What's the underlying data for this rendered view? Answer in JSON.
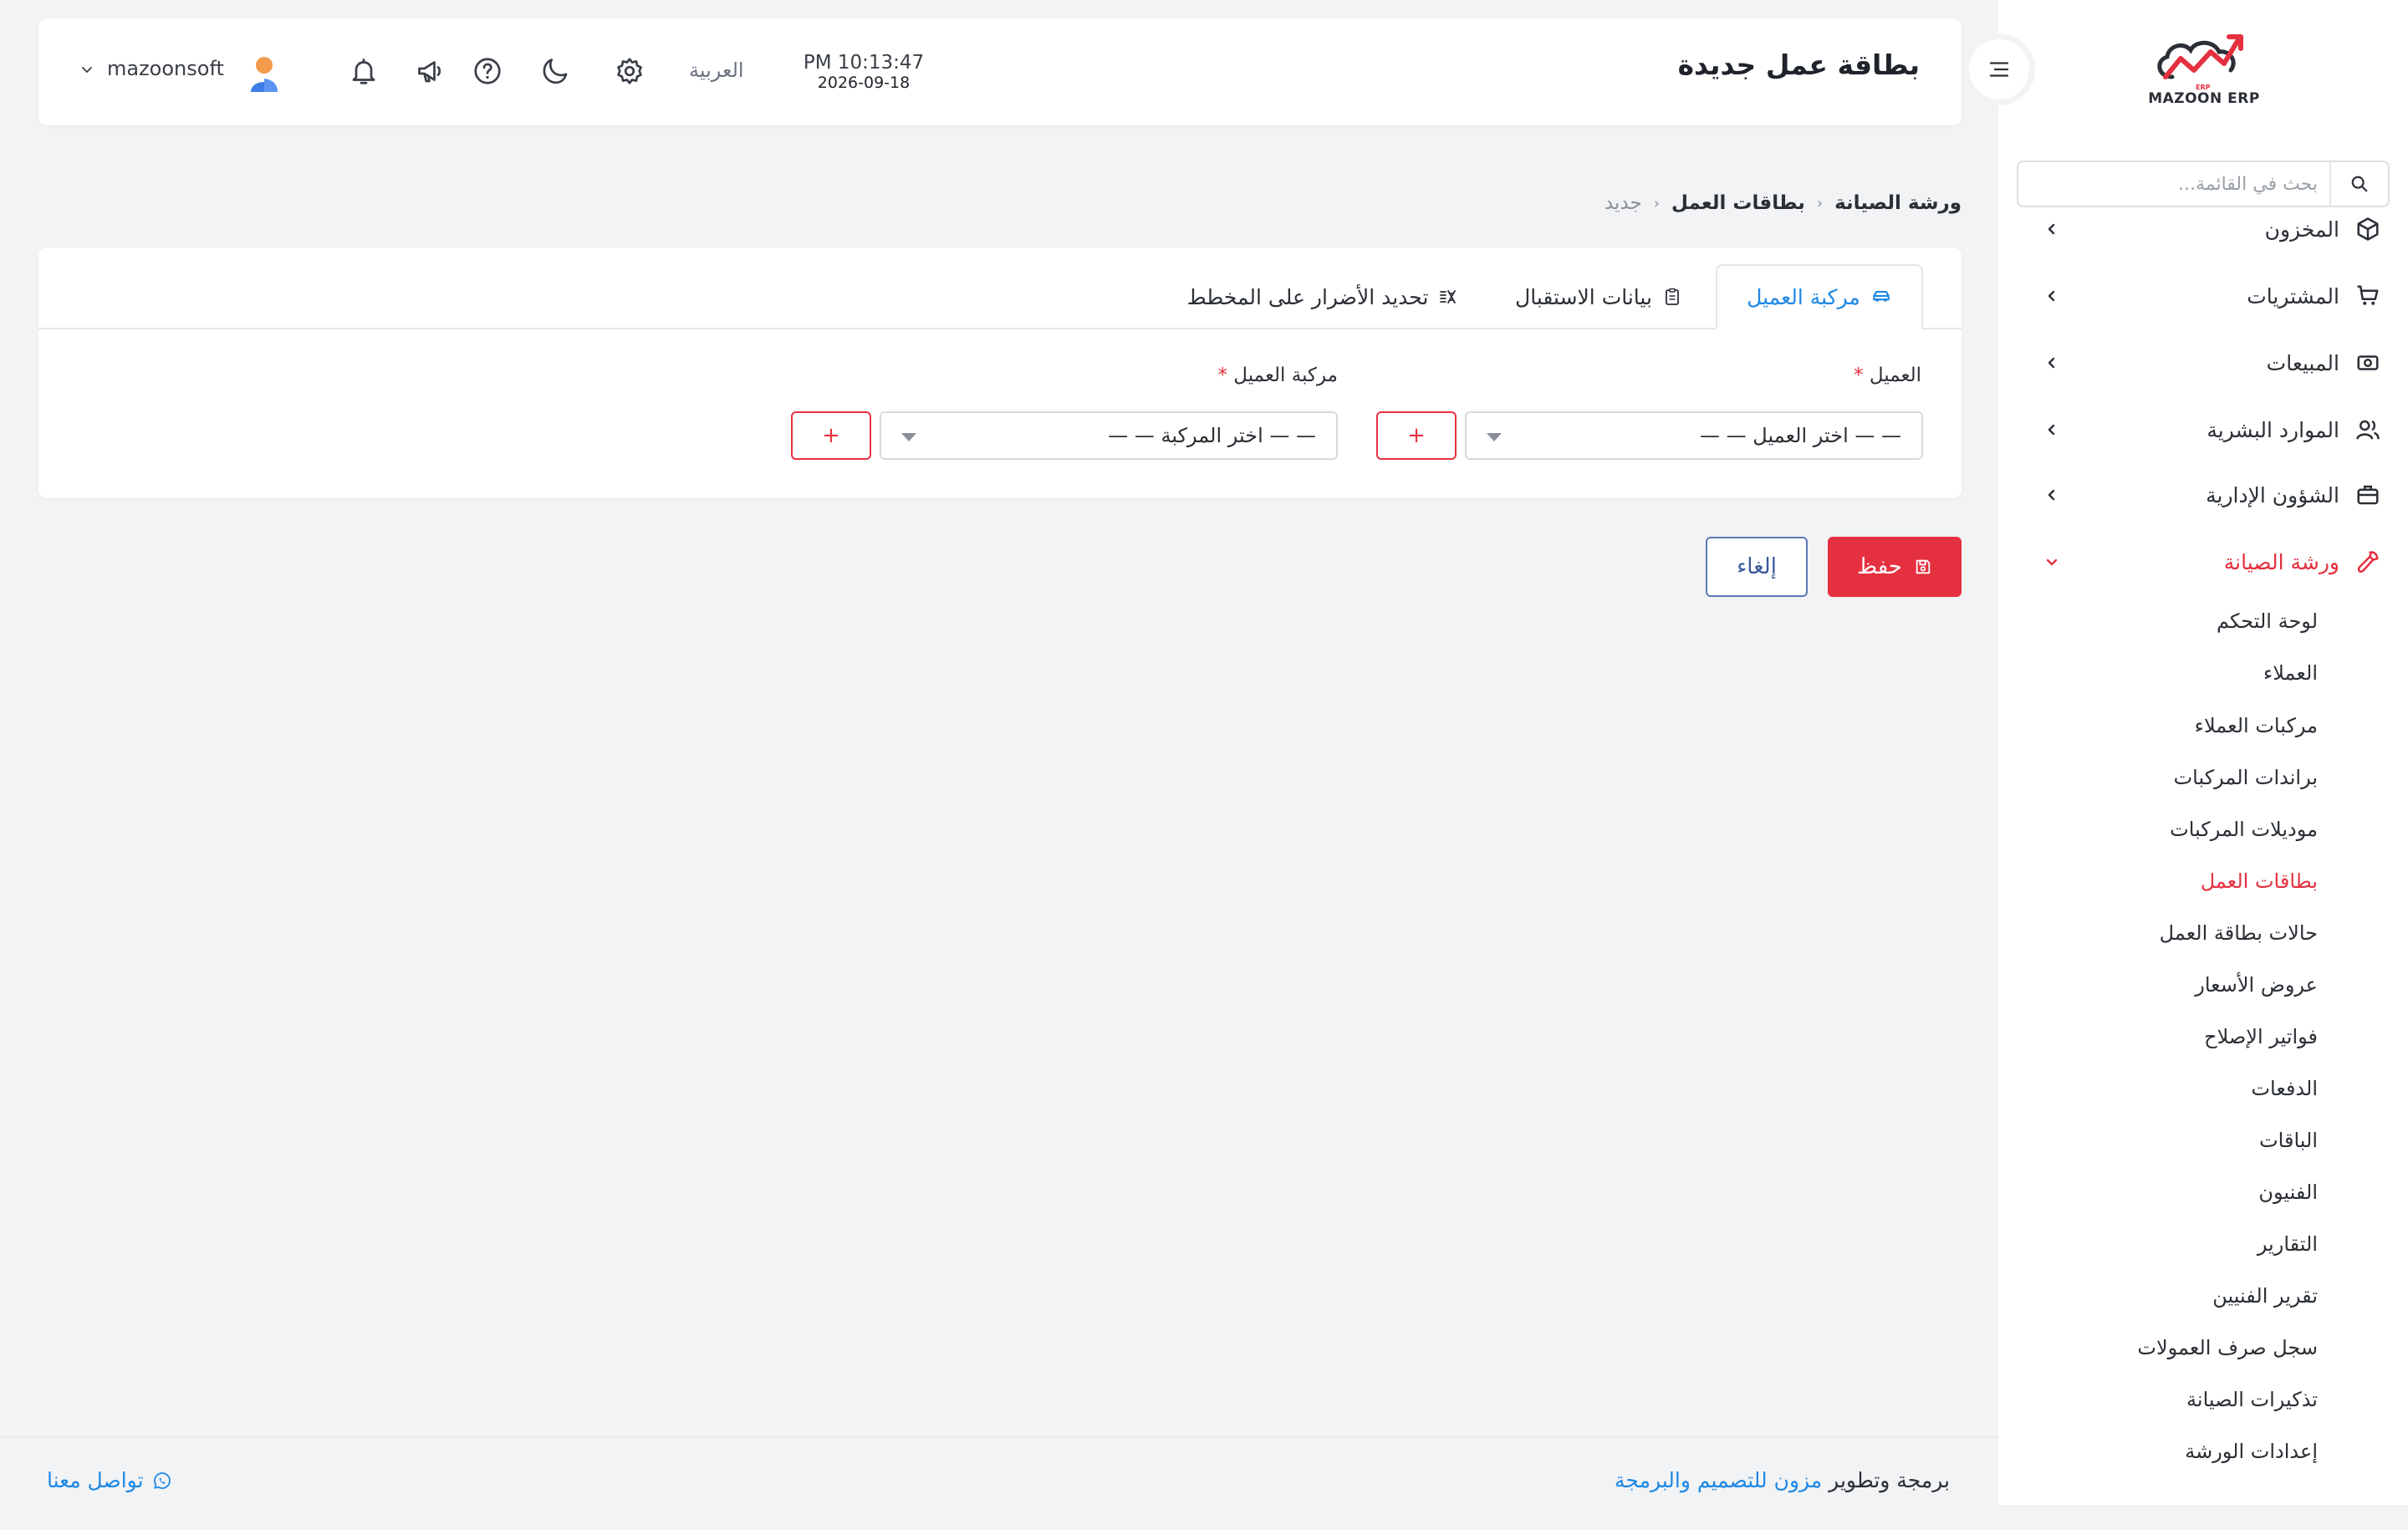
{
  "app": {
    "logo_text": "MAZOON ERP",
    "logo_small": "ERP"
  },
  "sidebar": {
    "search_placeholder": "بحث في القائمة...",
    "menu": [
      {
        "label": "المخزون",
        "icon": "box-icon"
      },
      {
        "label": "المشتريات",
        "icon": "cart-icon"
      },
      {
        "label": "المبيعات",
        "icon": "cash-icon"
      },
      {
        "label": "الموارد البشرية",
        "icon": "users-icon"
      },
      {
        "label": "الشؤون الإدارية",
        "icon": "briefcase-icon"
      },
      {
        "label": "ورشة الصيانة",
        "icon": "wrench-icon",
        "active": true
      }
    ],
    "submenu": [
      {
        "label": "لوحة التحكم"
      },
      {
        "label": "العملاء"
      },
      {
        "label": "مركبات العملاء"
      },
      {
        "label": "براندات المركبات"
      },
      {
        "label": "موديلات المركبات"
      },
      {
        "label": "بطاقات العمل",
        "active": true
      },
      {
        "label": "حالات بطاقة العمل"
      },
      {
        "label": "عروض الأسعار"
      },
      {
        "label": "فواتير الإصلاح"
      },
      {
        "label": "الدفعات"
      },
      {
        "label": "الباقات"
      },
      {
        "label": "الفنيون"
      },
      {
        "label": "التقارير"
      },
      {
        "label": "تقرير الفنيين"
      },
      {
        "label": "سجل صرف العمولات"
      },
      {
        "label": "تذكيرات الصيانة"
      },
      {
        "label": "إعدادات الورشة"
      }
    ]
  },
  "header": {
    "title": "بطاقة عمل جديدة",
    "time": "PM 10:13:47",
    "date": "2026-09-18",
    "language": "العربية",
    "username": "mazoonsoft"
  },
  "breadcrumb": {
    "items": [
      "ورشة الصيانة",
      "بطاقات العمل"
    ],
    "current": "جديد"
  },
  "tabs": [
    {
      "label": "مركبة العميل",
      "icon": "car-icon",
      "active": true
    },
    {
      "label": "بيانات الاستقبال",
      "icon": "clipboard-icon"
    },
    {
      "label": "تحديد الأضرار على المخطط",
      "icon": "car-damage-icon"
    }
  ],
  "form": {
    "customer_label": "العميل",
    "customer_value": "— — اختر العميل — —",
    "vehicle_label": "مركبة العميل",
    "vehicle_value": "— — اختر المركبة — —",
    "required_mark": "*",
    "add_label": "+"
  },
  "actions": {
    "save": "حفظ",
    "cancel": "إلغاء"
  },
  "footer": {
    "credit_prefix": "برمجة وتطوير",
    "credit_brand": "مزون للتصميم والبرمجة",
    "contact": "تواصل معنا"
  },
  "colors": {
    "accent": "#e5303f",
    "link": "#1e88e5",
    "cancel": "#3d5a99"
  }
}
